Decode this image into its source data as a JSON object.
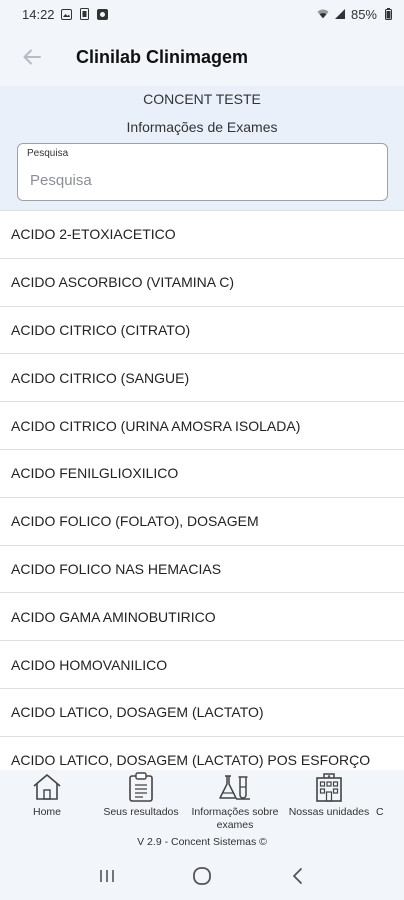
{
  "status_bar": {
    "time": "14:22",
    "battery": "85%"
  },
  "header": {
    "title": "Clinilab Clinimagem"
  },
  "company": "CONCENT TESTE",
  "section_title": "Informações de Exames",
  "search": {
    "legend": "Pesquisa",
    "placeholder": "Pesquisa",
    "value": ""
  },
  "exams": [
    "ACIDO 2-ETOXIACETICO",
    "ACIDO ASCORBICO (VITAMINA C)",
    "ACIDO CITRICO (CITRATO)",
    "ACIDO CITRICO (SANGUE)",
    "ACIDO CITRICO (URINA AMOSRA ISOLADA)",
    "ACIDO FENILGLIOXILICO",
    "ACIDO FOLICO (FOLATO), DOSAGEM",
    "ACIDO FOLICO NAS HEMACIAS",
    "ACIDO GAMA AMINOBUTIRICO",
    "ACIDO HOMOVANILICO",
    "ACIDO LATICO, DOSAGEM (LACTATO)",
    "ACIDO LATICO, DOSAGEM (LACTATO) POS ESFORÇO"
  ],
  "bottom_nav": {
    "items": [
      {
        "label": "Home",
        "icon": "home-icon"
      },
      {
        "label": "Seus resultados",
        "icon": "clipboard-icon"
      },
      {
        "label": "Informações sobre exames",
        "icon": "lab-flask-icon"
      },
      {
        "label": "Nossas unidades",
        "icon": "building-icon"
      },
      {
        "label": "C",
        "icon": "more-icon"
      }
    ],
    "version": "V 2.9 - Concent Sistemas ©"
  },
  "colors": {
    "header_bg": "#f2f5fa",
    "subheader_bg": "#eaf0fa",
    "divider": "#dcdfe4"
  }
}
